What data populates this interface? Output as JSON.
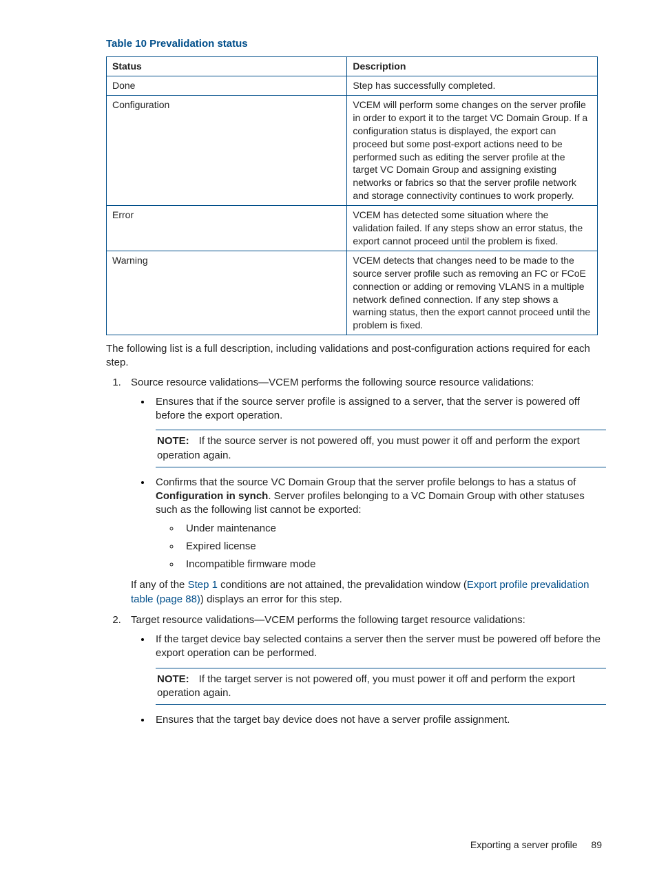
{
  "table": {
    "title": "Table 10 Prevalidation status",
    "headers": {
      "status": "Status",
      "description": "Description"
    },
    "rows": [
      {
        "status": "Done",
        "description": "Step has successfully completed."
      },
      {
        "status": "Configuration",
        "description": "VCEM will perform some changes on the server profile in order to export it to the target VC Domain Group. If a configuration status is displayed, the export can proceed but some post-export actions need to be performed such as editing the server profile at the target VC Domain Group and assigning existing networks or fabrics so that the server profile network and storage connectivity continues to work properly."
      },
      {
        "status": "Error",
        "description": "VCEM has detected some situation where the validation failed. If any steps show an error status, the export cannot proceed until the problem is fixed."
      },
      {
        "status": "Warning",
        "description": "VCEM detects that changes need to be made to the source server profile such as removing an FC or FCoE connection or adding or removing VLANS in a multiple network defined connection. If any step shows a warning status, then the export cannot proceed until the problem is fixed."
      }
    ]
  },
  "intro_para": "The following list is a full description, including validations and post-configuration actions required for each step.",
  "list": {
    "item1": {
      "lead": "Source resource validations—VCEM performs the following source resource validations:",
      "bullet1": "Ensures that if the source server profile is assigned to a server, that the server is powered off before the export operation.",
      "note1_label": "NOTE:",
      "note1_text": "If the source server is not powered off, you must power it off and perform the export operation again.",
      "bullet2_pre": "Confirms that the source VC Domain Group that the server profile belongs to has a status of ",
      "bullet2_bold": "Configuration in synch",
      "bullet2_post": ". Server profiles belonging to a VC Domain Group with other statuses such as the following list cannot be exported:",
      "sub1": "Under maintenance",
      "sub2": "Expired license",
      "sub3": "Incompatible firmware mode",
      "cond_pre": "If any of the ",
      "cond_link1": "Step 1",
      "cond_mid": " conditions are not attained, the prevalidation window (",
      "cond_link2": "Export profile prevalidation table (page 88)",
      "cond_post": ") displays an error for this step."
    },
    "item2": {
      "lead": "Target resource validations—VCEM performs the following target resource validations:",
      "bullet1": "If the target device bay selected contains a server then the server must be powered off before the export operation can be performed.",
      "note_label": "NOTE:",
      "note_text": "If the target server is not powered off, you must power it off and perform the export operation again.",
      "bullet2": "Ensures that the target bay device does not have a server profile assignment."
    }
  },
  "footer": {
    "section": "Exporting a server profile",
    "page": "89"
  }
}
